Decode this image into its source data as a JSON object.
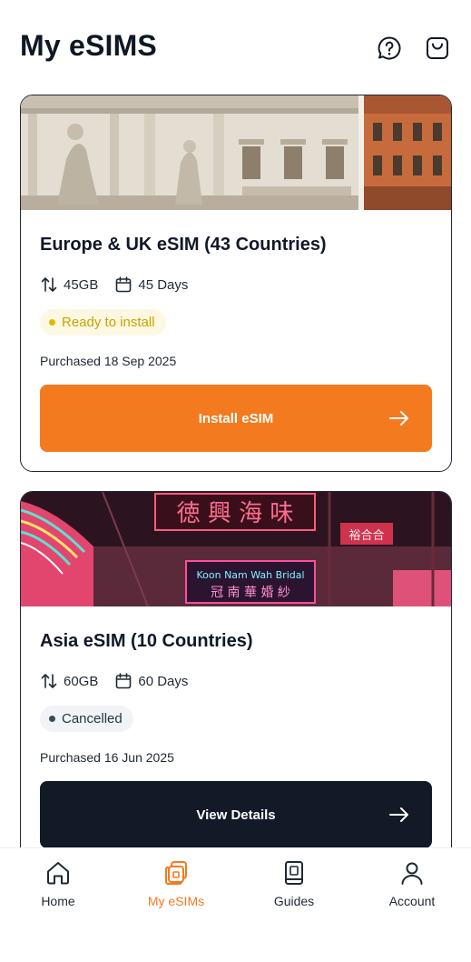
{
  "header": {
    "title": "My eSIMS",
    "help_icon": "help-circle-icon",
    "cart_icon": "shopping-bag-icon"
  },
  "esims": [
    {
      "title": "Europe & UK eSIM (43 Countries)",
      "data": "45GB",
      "duration": "45 Days",
      "status": "Ready to install",
      "purchased": "Purchased 18 Sep 2025",
      "action_label": "Install eSIM",
      "status_color": "#e5b800",
      "action_color": "#f47a1f"
    },
    {
      "title": "Asia eSIM (10 Countries)",
      "data": "60GB",
      "duration": "60 Days",
      "status": "Cancelled",
      "purchased": "Purchased 16 Jun 2025",
      "action_label": "View Details",
      "status_color": "#3e4856",
      "action_color": "#111a26"
    }
  ],
  "tabs": [
    {
      "label": "Home",
      "icon": "home-icon",
      "active": false
    },
    {
      "label": "My eSIMs",
      "icon": "esim-icon",
      "active": true
    },
    {
      "label": "Guides",
      "icon": "guide-icon",
      "active": false
    },
    {
      "label": "Account",
      "icon": "user-icon",
      "active": false
    }
  ],
  "colors": {
    "accent": "#f47a1f",
    "dark": "#111a26",
    "text": "#111827"
  }
}
